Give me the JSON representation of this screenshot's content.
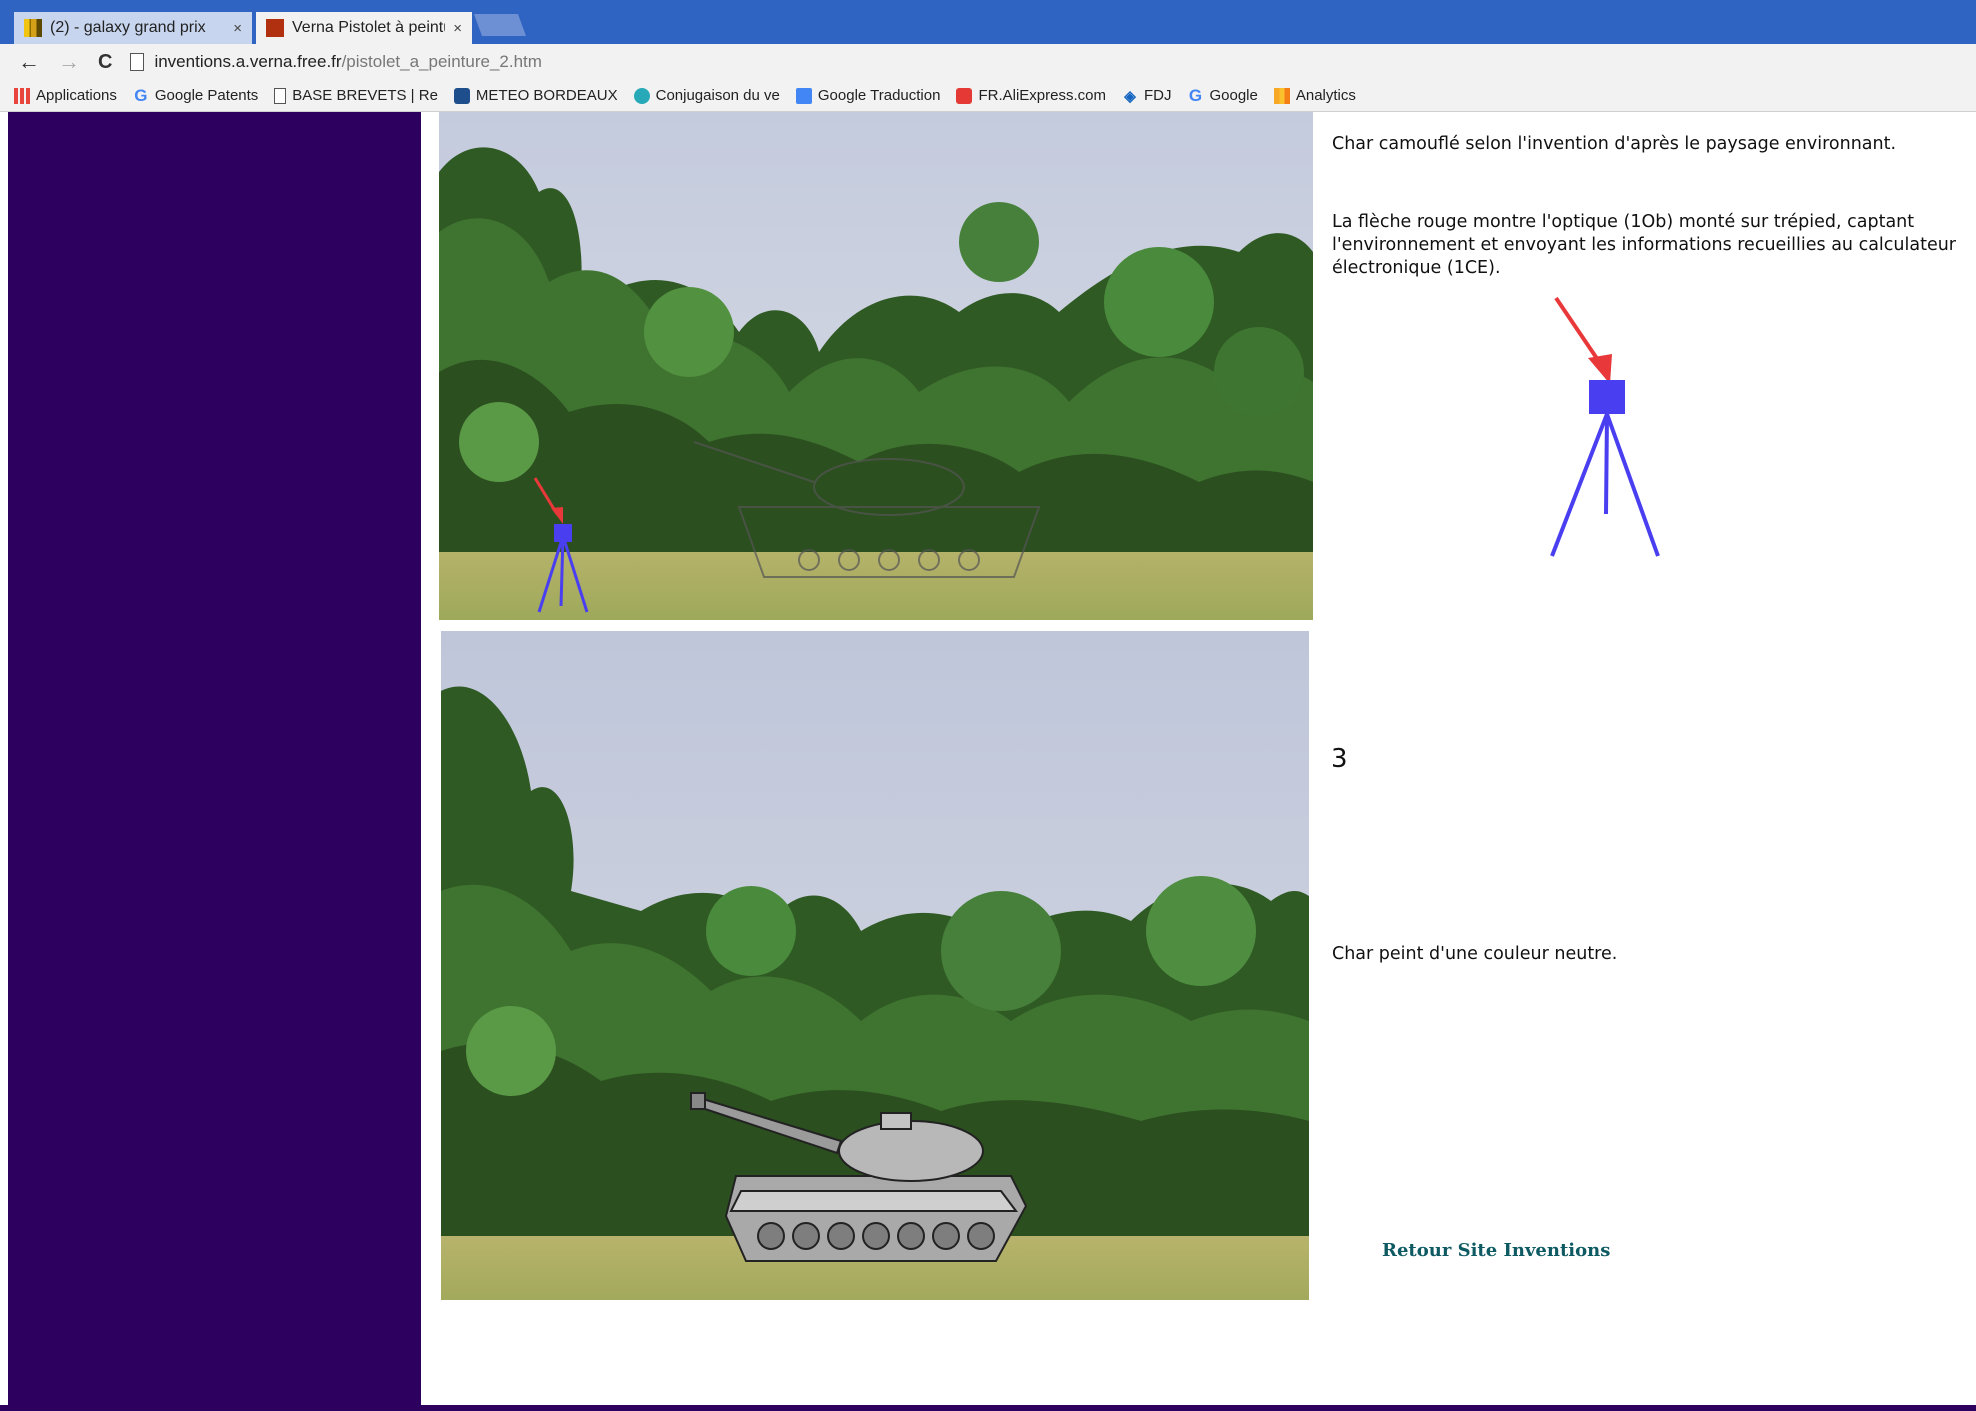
{
  "browser": {
    "tabs": [
      {
        "label": "(2) - galaxy grand prix",
        "active": false
      },
      {
        "label": "Verna Pistolet à peintu",
        "active": true
      }
    ],
    "close_glyph": "×",
    "url_host": "inventions.a.verna.free.fr",
    "url_path": "/pistolet_a_peinture_2.htm",
    "bookmarks": [
      {
        "label": "Applications",
        "icon": "apps-grid-icon"
      },
      {
        "label": "Google Patents",
        "icon": "google-icon"
      },
      {
        "label": "BASE BREVETS | Re",
        "icon": "page-icon"
      },
      {
        "label": "METEO BORDEAUX",
        "icon": "meteo-icon"
      },
      {
        "label": "Conjugaison du ve",
        "icon": "conjugaison-icon"
      },
      {
        "label": "Google Traduction",
        "icon": "translate-icon"
      },
      {
        "label": "FR.AliExpress.com",
        "icon": "aliexpress-icon"
      },
      {
        "label": "FDJ",
        "icon": "fdj-icon"
      },
      {
        "label": "Google",
        "icon": "google-icon"
      },
      {
        "label": "Analytics",
        "icon": "analytics-icon"
      }
    ]
  },
  "colors": {
    "sidebar": "#2d005f",
    "link": "#0e5a63",
    "arrow": "#e8383a",
    "optic": "#4a3ff0"
  },
  "content": {
    "caption_camouflaged": "Char camouflé selon l'invention d'après le paysage environnant.",
    "caption_arrow": "La flèche rouge montre l'optique (1Ob) monté sur trépied, captant l'environnement et envoyant les informations recueillies au calculateur électronique (1CE).",
    "figure_number": "3",
    "caption_neutral": "Char peint d'une couleur neutre.",
    "back_link": "Retour Site Inventions"
  }
}
